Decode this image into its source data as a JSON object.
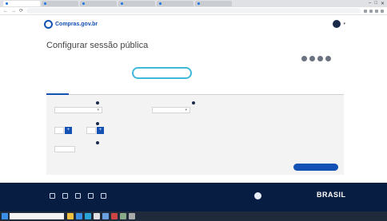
{
  "browser": {
    "tabs": [
      {
        "label": "",
        "active": true
      },
      {
        "label": "",
        "active": false
      },
      {
        "label": "",
        "active": false
      },
      {
        "label": "",
        "active": false
      },
      {
        "label": "",
        "active": false
      },
      {
        "label": "",
        "active": false
      }
    ],
    "url": "",
    "back_glyph": "←",
    "forward_glyph": "→",
    "reload_glyph": "⟳",
    "window_controls": [
      "–",
      "□",
      "✕"
    ]
  },
  "header": {
    "logo_text": "Compras.gov.br",
    "header_link": "",
    "user_initial": "",
    "user_caret": "▾"
  },
  "page": {
    "breadcrumb": "",
    "title": "Configurar sessão pública",
    "title_tools": "",
    "edital_name": "",
    "meta_line_1": "",
    "meta_line_2_prefix": "",
    "meta_line_2_link": "",
    "meta_line_3": "",
    "circle_buttons": 4
  },
  "tabs": [
    {
      "label": "",
      "active": true
    },
    {
      "label": "",
      "active": false
    }
  ],
  "form": {
    "field1_label": "",
    "field1_value": "",
    "field2_label": "",
    "field2_value": "",
    "field2_hint": "",
    "field3_label": "",
    "field3_value_a": "",
    "field3_text_a": "",
    "field3_value_b": "",
    "field3_text_b": "",
    "field4_label": "",
    "field4_value": "",
    "step_glyph": "+",
    "caret_glyph": "▾",
    "submit_label": ""
  },
  "footer": {
    "social_icons": [
      "facebook-icon",
      "twitter-icon",
      "instagram-icon",
      "linkedin-icon",
      "whatsapp-icon"
    ],
    "left_logo_text": "",
    "mid_text": "",
    "brasil_text": "BRASIL"
  },
  "taskbar": {
    "search_placeholder": "",
    "apps": [
      {
        "name": "explorer-icon",
        "color": "#f0c040"
      },
      {
        "name": "store-icon",
        "color": "#3a8ee6"
      },
      {
        "name": "edge-icon",
        "color": "#2aa3d6"
      },
      {
        "name": "chrome-icon",
        "color": "#e0e0e0"
      },
      {
        "name": "mail-icon",
        "color": "#6aa0e0"
      },
      {
        "name": "app-icon",
        "color": "#c44"
      },
      {
        "name": "app-icon",
        "color": "#8a8"
      },
      {
        "name": "app-icon",
        "color": "#aaa"
      }
    ],
    "tray_text": ""
  },
  "colors": {
    "primary": "#1351b4",
    "footer_bg": "#071d41",
    "highlight": "#3fb8d9",
    "panel_bg": "#f3f3f3"
  }
}
